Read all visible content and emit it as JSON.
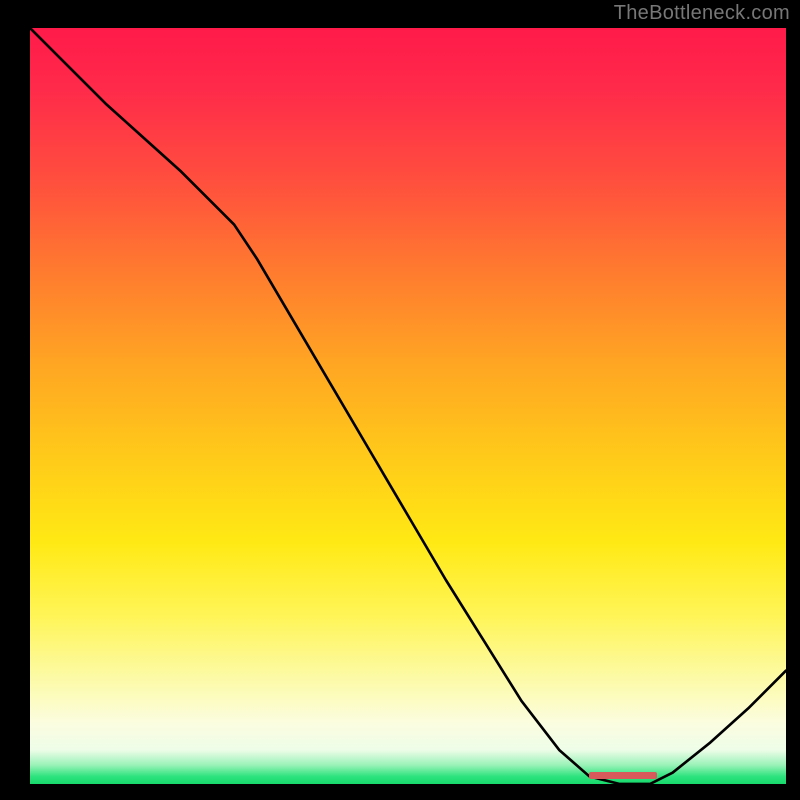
{
  "watermark": "TheBottleneck.com",
  "chart_data": {
    "type": "line",
    "title": "",
    "xlabel": "",
    "ylabel": "",
    "xlim": [
      0,
      100
    ],
    "ylim": [
      0,
      100
    ],
    "grid": false,
    "legend": false,
    "gradient_stops": [
      {
        "pos": 0,
        "color": "#ff1a4a"
      },
      {
        "pos": 8,
        "color": "#ff2a4a"
      },
      {
        "pos": 20,
        "color": "#ff4e3e"
      },
      {
        "pos": 32,
        "color": "#ff7a2f"
      },
      {
        "pos": 44,
        "color": "#ffa423"
      },
      {
        "pos": 56,
        "color": "#ffc81a"
      },
      {
        "pos": 68,
        "color": "#ffe914"
      },
      {
        "pos": 78,
        "color": "#fff559"
      },
      {
        "pos": 87,
        "color": "#fcfbb0"
      },
      {
        "pos": 92,
        "color": "#fbfde0"
      },
      {
        "pos": 95.5,
        "color": "#eefde8"
      },
      {
        "pos": 97.5,
        "color": "#9af2b8"
      },
      {
        "pos": 99,
        "color": "#2de37e"
      },
      {
        "pos": 100,
        "color": "#17d96b"
      }
    ],
    "series": [
      {
        "name": "bottleneck-curve",
        "color": "#000000",
        "x": [
          0,
          5,
          10,
          15,
          20,
          25,
          27,
          30,
          35,
          40,
          45,
          50,
          55,
          60,
          65,
          70,
          74,
          78,
          82,
          85,
          90,
          95,
          100
        ],
        "y": [
          100,
          95,
          90,
          85.5,
          81,
          76,
          74,
          69.5,
          61,
          52.5,
          44,
          35.5,
          27,
          19,
          11,
          4.5,
          1.0,
          0.0,
          0.0,
          1.5,
          5.5,
          10,
          15
        ]
      }
    ],
    "annotations": [
      {
        "name": "optimal-marker",
        "color": "#d85a5a",
        "x_start": 74,
        "x_end": 83,
        "y": 0.6
      }
    ]
  }
}
